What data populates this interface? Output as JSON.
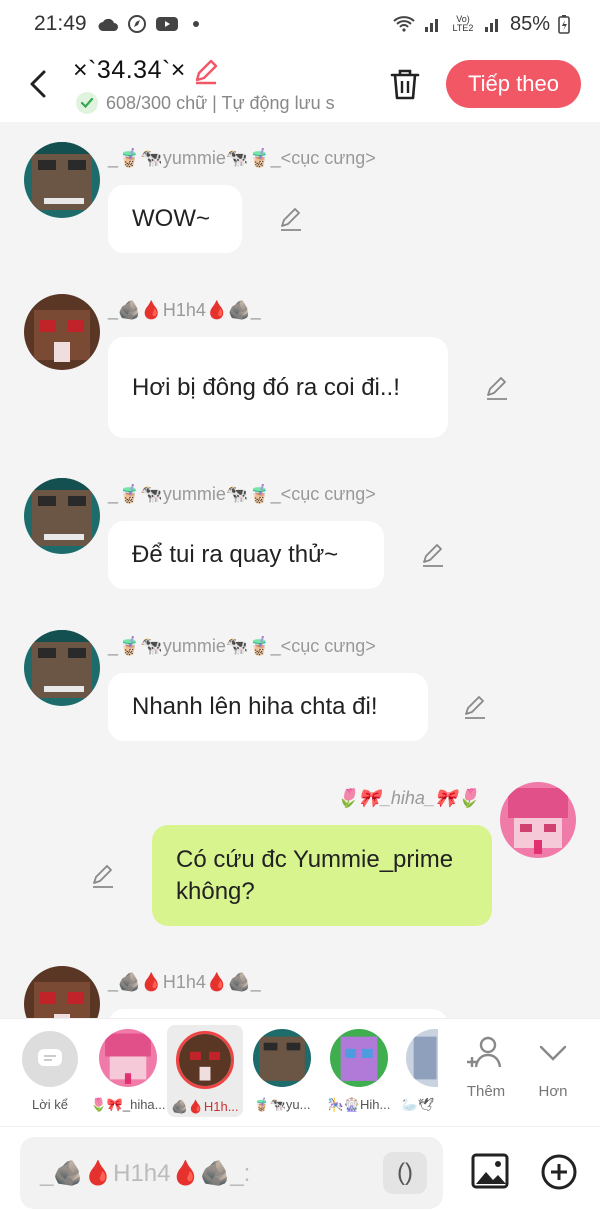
{
  "status": {
    "time": "21:49",
    "battery": "85%",
    "net_label": "Vo) LTE2"
  },
  "header": {
    "title": "×`34.34`×",
    "subtitle": "608/300 chữ | Tự động lưu s",
    "next_label": "Tiếp theo",
    "accent": "#f25766"
  },
  "messages": [
    {
      "sender": "_🧋🐄yummie🐄🧋_<cục cưng>",
      "text": "WOW~"
    },
    {
      "sender": "_🪨🩸H1h4🩸🪨_",
      "text": "Hơi bị đông đó ra coi đi..!"
    },
    {
      "sender": "_🧋🐄yummie🐄🧋_<cục cưng>",
      "text": "Để tui ra quay thử~"
    },
    {
      "sender": "_🧋🐄yummie🐄🧋_<cục cưng>",
      "text": "Nhanh lên hiha chta đi!"
    },
    {
      "sender": "🌷🎀_hiha_🎀🌷",
      "text": "Có cứu đc Yummie_prime không?"
    },
    {
      "sender": "_🪨🩸H1h4🩸🪨_",
      "text": ""
    }
  ],
  "characters": {
    "suggest_label": "Lời kể",
    "items": [
      {
        "label": "🌷🎀_hiha..."
      },
      {
        "label": "🪨🩸H1h..."
      },
      {
        "label": "🧋🐄yu..."
      },
      {
        "label": "🎠🎡Hih..."
      },
      {
        "label": "🦢🕊"
      }
    ],
    "more_label": "Thêm",
    "other_label": "Hơn"
  },
  "input": {
    "placeholder": "_🪨🩸H1h4🩸🪨_:",
    "paren_label": "()"
  },
  "colors": {
    "my_bubble": "#d8f48e",
    "other_bubble": "#ffffff",
    "background": "#f4f4f4"
  }
}
